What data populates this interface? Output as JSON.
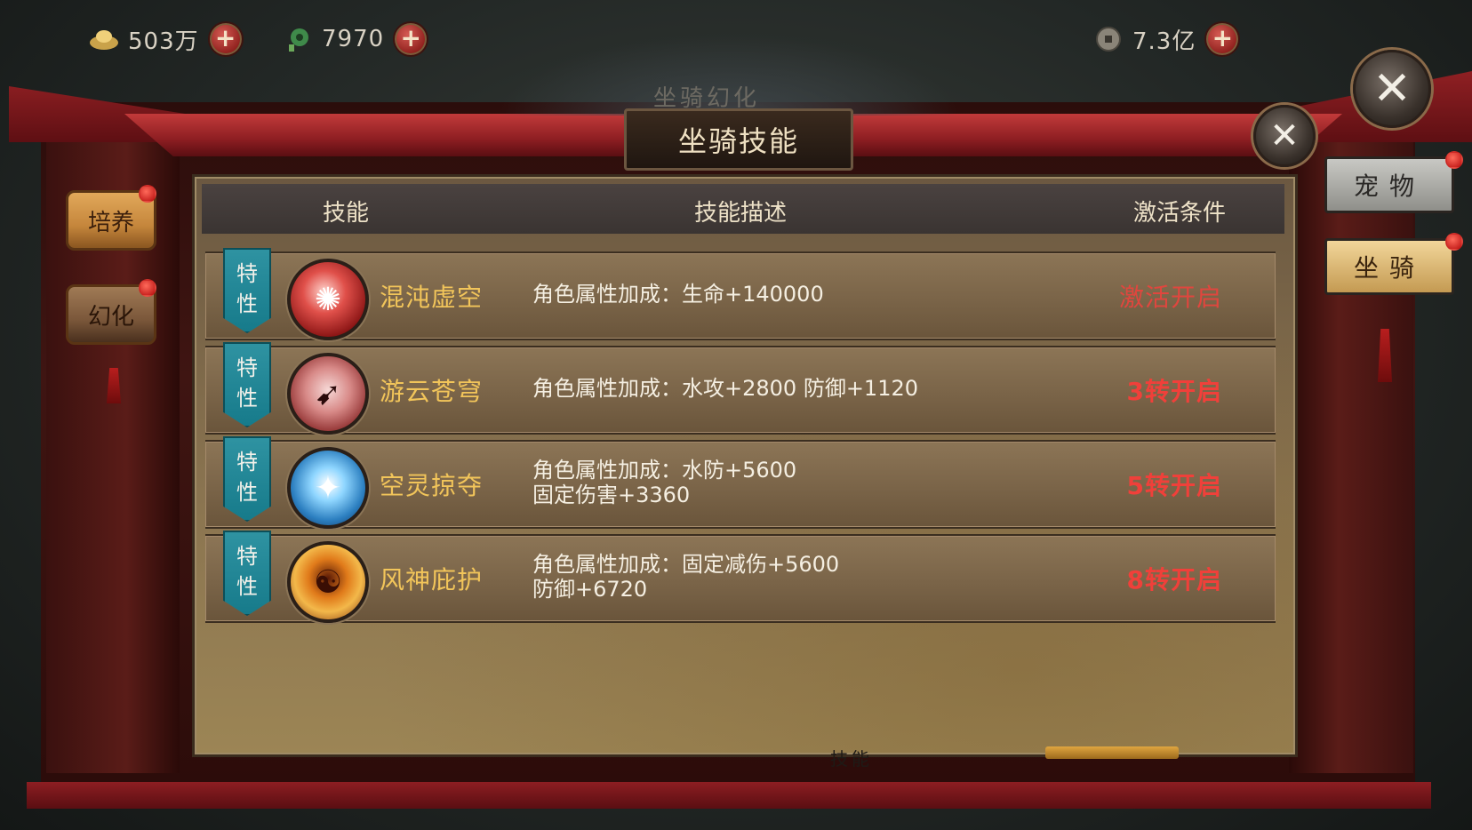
{
  "currencies": [
    {
      "icon": "gold-ingot-icon",
      "value": "503万"
    },
    {
      "icon": "jade-icon",
      "value": "7970"
    },
    {
      "icon": "coin-icon",
      "value": "7.3亿"
    }
  ],
  "window": {
    "ghost_title": "坐骑幻化",
    "title": "坐骑技能",
    "bottom_label": "技能"
  },
  "table": {
    "headers": {
      "skill": "技能",
      "description": "技能描述",
      "condition": "激活条件"
    },
    "badge_text": [
      "特",
      "性"
    ],
    "rows": [
      {
        "name": "混沌虚空",
        "icon": "chaos-void-icon",
        "desc_line1": "角色属性加成：生命+140000",
        "desc_line2": "",
        "condition": "激活开启"
      },
      {
        "name": "游云苍穹",
        "icon": "wandering-cloud-icon",
        "desc_line1": "角色属性加成：水攻+2800 防御+1120",
        "desc_line2": "",
        "condition": "3转开启"
      },
      {
        "name": "空灵掠夺",
        "icon": "ethereal-plunder-icon",
        "desc_line1": "角色属性加成：水防+5600",
        "desc_line2": "固定伤害+3360",
        "condition": "5转开启"
      },
      {
        "name": "风神庇护",
        "icon": "wind-god-shield-icon",
        "desc_line1": "角色属性加成：固定减伤+5600",
        "desc_line2": "防御+6720",
        "condition": "8转开启"
      }
    ]
  },
  "left_tabs": [
    {
      "label": "培养"
    },
    {
      "label": "幻化"
    }
  ],
  "right_tabs": [
    {
      "label": "宠物"
    },
    {
      "label": "坐骑"
    }
  ],
  "colors": {
    "condition_red": "#f0403a",
    "skill_name_gold": "#f2c55a",
    "badge_teal": "#1f8a9a"
  }
}
